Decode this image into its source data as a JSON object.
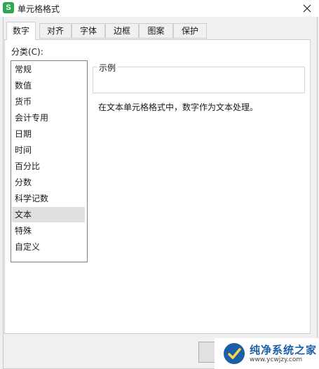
{
  "window": {
    "app_icon_letter": "S",
    "title": "单元格格式",
    "close_icon": "close-icon"
  },
  "tabs": [
    {
      "label": "数字",
      "active": true
    },
    {
      "label": "对齐",
      "active": false
    },
    {
      "label": "字体",
      "active": false
    },
    {
      "label": "边框",
      "active": false
    },
    {
      "label": "图案",
      "active": false
    },
    {
      "label": "保护",
      "active": false
    }
  ],
  "category": {
    "label": "分类(C):",
    "items": [
      "常规",
      "数值",
      "货币",
      "会计专用",
      "日期",
      "时间",
      "百分比",
      "分数",
      "科学记数",
      "文本",
      "特殊",
      "自定义"
    ],
    "selected": "文本"
  },
  "sample": {
    "title": "示例"
  },
  "description": "在文本单元格格式中，数字作为文本处理。",
  "watermark": {
    "name": "纯净系统之家",
    "url": "www.ycwjzy.com"
  }
}
